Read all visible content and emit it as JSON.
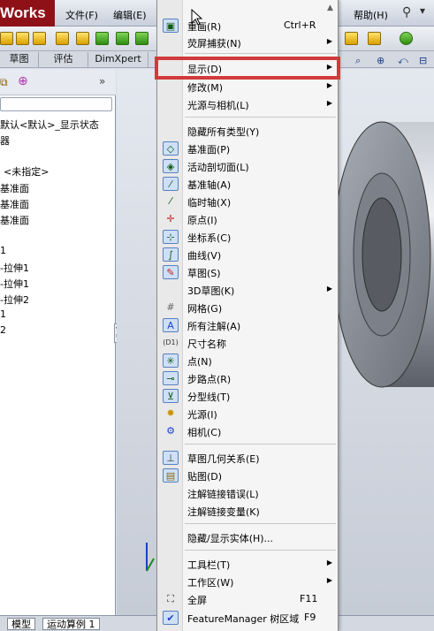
{
  "app": {
    "brand": "Works"
  },
  "top_menu": {
    "file": "文件(F)",
    "edit": "编辑(E)",
    "help": "帮助(H)"
  },
  "cm_tabs": [
    "草图",
    "评估",
    "DimXpert"
  ],
  "bottom_tabs": [
    "模型",
    "运动算例 1"
  ],
  "left_pane": {
    "items": [
      "默认<默认>_显示状态",
      "器",
      "<未指定>",
      "基准面",
      "基准面",
      "基准面",
      "1",
      "-拉伸1",
      "-拉伸1",
      "-拉伸2",
      "1",
      "2"
    ]
  },
  "context_menu": {
    "items": [
      {
        "label": "重画(R)",
        "shortcut": "Ctrl+R",
        "icon": "redraw-icon"
      },
      {
        "label": "荧屏捕获(N)",
        "submenu": true
      },
      {
        "label": "显示(D)",
        "submenu": true,
        "highlighted": true
      },
      {
        "label": "修改(M)",
        "submenu": true
      },
      {
        "label": "光源与相机(L)",
        "submenu": true
      },
      {
        "label": "隐藏所有类型(Y)"
      },
      {
        "label": "基准面(P)",
        "icon": "plane-icon"
      },
      {
        "label": "活动剖切面(L)",
        "icon": "section-plane-icon"
      },
      {
        "label": "基准轴(A)",
        "icon": "axis-icon"
      },
      {
        "label": "临时轴(X)",
        "icon": "temp-axis-icon"
      },
      {
        "label": "原点(I)",
        "icon": "origin-icon"
      },
      {
        "label": "坐标系(C)",
        "icon": "coordinate-system-icon"
      },
      {
        "label": "曲线(V)",
        "icon": "curve-icon"
      },
      {
        "label": "草图(S)",
        "icon": "sketch-icon"
      },
      {
        "label": "3D草图(K)",
        "submenu": true
      },
      {
        "label": "网格(G)",
        "icon": "grid-icon"
      },
      {
        "label": "所有注解(A)",
        "icon": "annotation-icon"
      },
      {
        "label": "尺寸名称",
        "icon": "dimension-name-icon"
      },
      {
        "label": "点(N)",
        "icon": "point-icon"
      },
      {
        "label": "步路点(R)",
        "icon": "route-point-icon"
      },
      {
        "label": "分型线(T)",
        "icon": "parting-line-icon"
      },
      {
        "label": "光源(I)",
        "icon": "light-icon"
      },
      {
        "label": "相机(C)",
        "icon": "camera-icon"
      },
      {
        "label": "草图几何关系(E)",
        "icon": "sketch-relation-icon"
      },
      {
        "label": "贴图(D)",
        "icon": "decal-icon"
      },
      {
        "label": "注解链接错误(L)"
      },
      {
        "label": "注解链接变量(K)"
      },
      {
        "label": "隐藏/显示实体(H)..."
      },
      {
        "label": "工具栏(T)",
        "submenu": true
      },
      {
        "label": "工作区(W)",
        "submenu": true
      },
      {
        "label": "全屏",
        "shortcut": "F11",
        "icon": "fullscreen-icon"
      },
      {
        "label": "FeatureManager 树区域",
        "shortcut": "F9",
        "icon": "check-icon"
      }
    ]
  },
  "colors": {
    "highlight_box": "#d23a3a",
    "brand_bg": "#8f1118",
    "part_body": "#9aa0a8"
  }
}
